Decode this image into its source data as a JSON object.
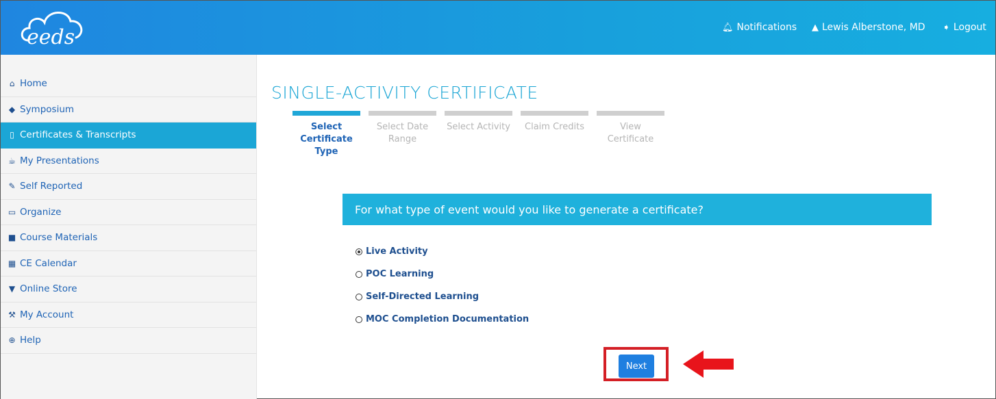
{
  "header": {
    "logo_text": "eeds",
    "notifications_label": "Notifications",
    "user_name": "Lewis Alberstone, MD",
    "logout_label": "Logout"
  },
  "sidebar": {
    "items": [
      {
        "label": "Home",
        "icon": "home-icon"
      },
      {
        "label": "Symposium",
        "icon": "graduation-cap-icon"
      },
      {
        "label": "Certificates & Transcripts",
        "icon": "file-icon",
        "active": true
      },
      {
        "label": "My Presentations",
        "icon": "trophy-icon"
      },
      {
        "label": "Self Reported",
        "icon": "edit-icon"
      },
      {
        "label": "Organize",
        "icon": "folder-open-icon"
      },
      {
        "label": "Course Materials",
        "icon": "archive-icon"
      },
      {
        "label": "CE Calendar",
        "icon": "calendar-icon"
      },
      {
        "label": "Online Store",
        "icon": "shopping-cart-icon"
      },
      {
        "label": "My Account",
        "icon": "wrench-icon"
      },
      {
        "label": "Help",
        "icon": "life-ring-icon"
      }
    ]
  },
  "main": {
    "title": "SINGLE-ACTIVITY CERTIFICATE",
    "steps": [
      {
        "label": "Select Certificate Type",
        "lines": [
          "Select",
          "Certificate",
          "Type"
        ],
        "active": true
      },
      {
        "label": "Select Date Range",
        "lines": [
          "Select Date",
          "Range"
        ],
        "active": false
      },
      {
        "label": "Select Activity",
        "lines": [
          "Select Activity"
        ],
        "active": false
      },
      {
        "label": "Claim Credits",
        "lines": [
          "Claim Credits"
        ],
        "active": false
      },
      {
        "label": "View Certificate",
        "lines": [
          "View",
          "Certificate"
        ],
        "active": false
      }
    ],
    "question": "For what type of event would you like to generate a certificate?",
    "options": [
      {
        "label": "Live Activity",
        "selected": true
      },
      {
        "label": "POC Learning",
        "selected": false
      },
      {
        "label": "Self-Directed Learning",
        "selected": false
      },
      {
        "label": "MOC Completion Documentation",
        "selected": false
      }
    ],
    "next_label": "Next"
  },
  "colors": {
    "header_gradient_start": "#1f86e0",
    "header_gradient_end": "#17aee0",
    "accent": "#1ba6d6",
    "link": "#1e63b5",
    "highlight_red": "#d41f25",
    "button": "#1f7fe0"
  }
}
